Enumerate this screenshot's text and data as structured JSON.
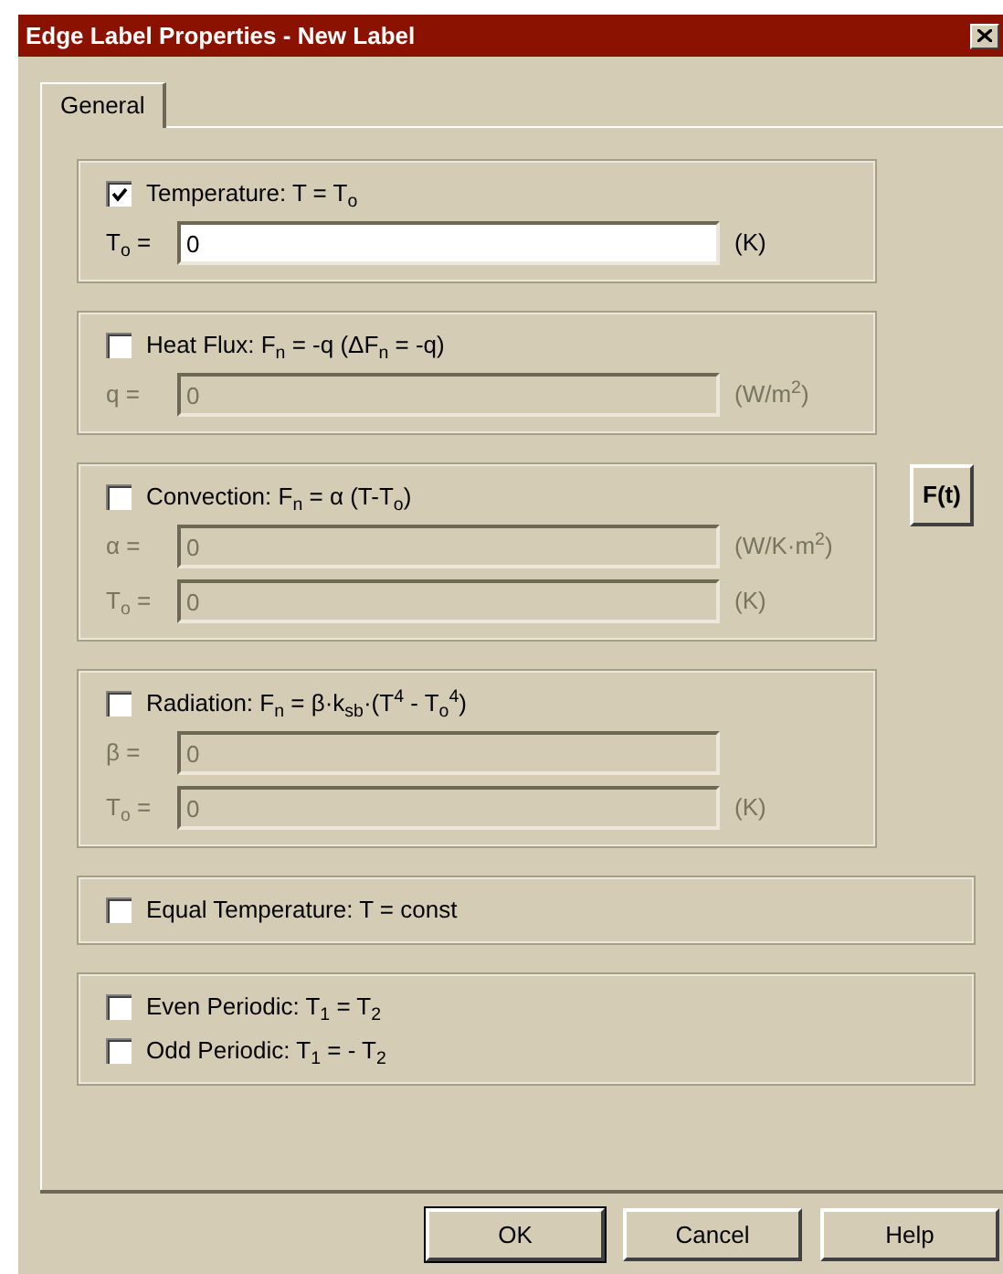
{
  "window": {
    "title": "Edge Label Properties - New Label"
  },
  "tabs": [
    {
      "label": "General",
      "selected": true
    }
  ],
  "groups": [
    {
      "wide": false,
      "options": [
        {
          "label": "Temperature: T = T$_{o}$",
          "checked": true
        }
      ],
      "fields": [
        {
          "label": "T$_{o}$ =",
          "value": "0",
          "unit": "(K)",
          "disabled": false
        }
      ]
    },
    {
      "wide": false,
      "options": [
        {
          "label": "Heat Flux: F$_{n}$ = -q (ΔF$_{n}$ = -q)",
          "checked": false
        }
      ],
      "fields": [
        {
          "label": "q =",
          "value": "0",
          "unit": "(W/m$^{2}$)",
          "disabled": true
        }
      ]
    },
    {
      "wide": false,
      "side_button": "F(t)",
      "options": [
        {
          "label": "Convection: F$_{n}$ = α (T-T$_{o}$)",
          "checked": false
        }
      ],
      "fields": [
        {
          "label": "α =",
          "value": "0",
          "unit": "(W/K·m$^{2}$)",
          "disabled": true
        },
        {
          "label": "T$_{o}$ =",
          "value": "0",
          "unit": "(K)",
          "disabled": true
        }
      ]
    },
    {
      "wide": false,
      "options": [
        {
          "label": "Radiation: F$_{n}$ = β·k$_{sb}$·(T$^{4}$ - T$_{o}$$^{4}$)",
          "checked": false
        }
      ],
      "fields": [
        {
          "label": "β =",
          "value": "0",
          "disabled": true
        },
        {
          "label": "T$_{o}$ =",
          "value": "0",
          "unit": "(K)",
          "disabled": true
        }
      ]
    },
    {
      "wide": true,
      "options": [
        {
          "label": "Equal Temperature: T = const",
          "checked": false
        }
      ]
    },
    {
      "wide": true,
      "options": [
        {
          "label": "Even Periodic: T$_{1}$ = T$_{2}$",
          "checked": false
        },
        {
          "label": "Odd Periodic: T$_{1}$ = - T$_{2}$",
          "checked": false
        }
      ]
    }
  ],
  "buttons": [
    {
      "label": "OK",
      "default": true
    },
    {
      "label": "Cancel",
      "default": false
    },
    {
      "label": "Help",
      "default": false
    }
  ]
}
